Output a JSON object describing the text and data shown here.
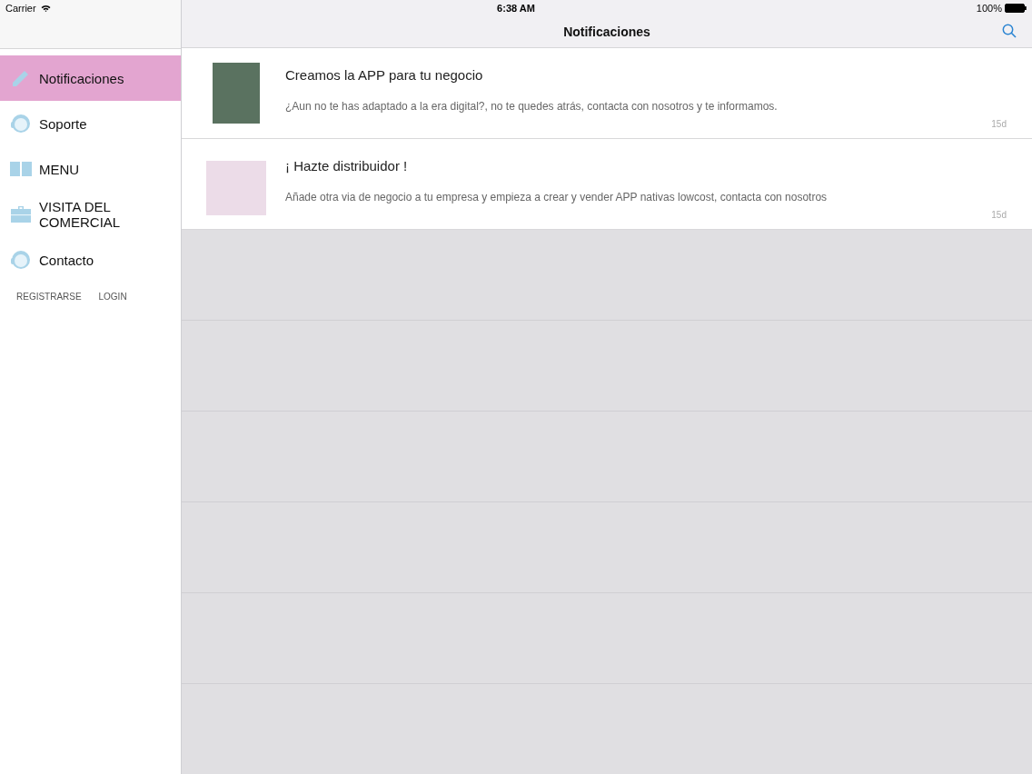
{
  "status_bar": {
    "carrier": "Carrier",
    "time": "6:38 AM",
    "battery": "100%"
  },
  "nav_bar": {
    "title": "Notificaciones"
  },
  "sidebar": {
    "items": [
      {
        "label": "Notificaciones",
        "kind": "pencil",
        "selected": true
      },
      {
        "label": "Soporte",
        "kind": "headset",
        "selected": false
      },
      {
        "label": "MENU",
        "kind": "book",
        "selected": false
      },
      {
        "label": "VISITA DEL COMERCIAL",
        "kind": "briefcase",
        "selected": false
      },
      {
        "label": "Contacto",
        "kind": "headset",
        "selected": false
      }
    ],
    "links": [
      "REGISTRARSE",
      "LOGIN"
    ]
  },
  "notifications": [
    {
      "title": "Creamos la APP para tu negocio",
      "body": "¿Aun no te has adaptado a la era digital?, no te quedes atrás, contacta con nosotros y te informamos.",
      "age": "15d",
      "kind": "phone"
    },
    {
      "title": "¡ Hazte distribuidor !",
      "body": "Añade otra via de negocio a tu empresa y empieza a crear y vender APP nativas lowcost, contacta con nosotros",
      "age": "15d",
      "kind": "flyer"
    }
  ]
}
